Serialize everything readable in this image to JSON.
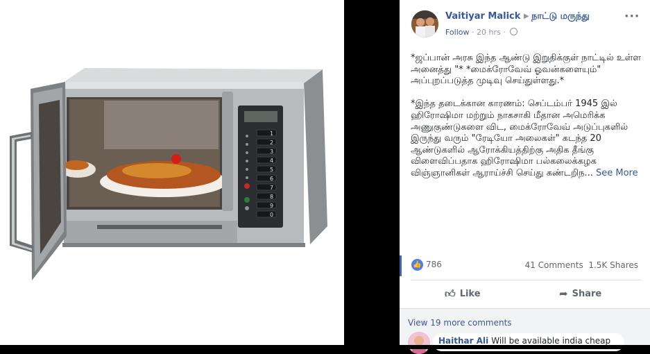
{
  "post": {
    "author": "Vaitiyar Malick",
    "page": "நாட்டு மருந்து",
    "follow": "Follow",
    "time": "20 hrs",
    "paragraph1": "*ஜப்பான் அரசு இந்த ஆண்டு இறுதிக்குள் நாட்டில் உள்ள அனைத்து \"* *மைக்ரோவேவ் ஓவன்களையும்\" அப்புறப்படுத்த முடிவு செய்துள்ளது.*",
    "paragraph2": "*இந்த தடைக்கான காரணம்: செப்டம்பர் 1945 இல் ஹிரோஷிமா மற்றும் நாகசாகி மீதான அமெரிக்க அணுகுண்டுகளை விட, மைக்ரோவேவ் அடுப்புகளில் இருந்து வரும் \"ரேடியோ அலைகள்\" கடந்த 20 ஆண்டுகளில் ஆரோக்கியத்திற்கு அதிக தீங்கு விளைவிப்பதாக ஹிரோஷிமா பல்கலைக்கழக விஞ்ஞானிகள் ஆராய்ச்சி செய்து கண்டறிந...",
    "see_more": "See More"
  },
  "stats": {
    "reactions": "786",
    "comments": "41 Comments",
    "shares": "1.5K Shares"
  },
  "actions": {
    "like": "Like",
    "share": "Share"
  },
  "comments": {
    "view_more": "View 19 more comments",
    "first_author": "Haithar Ali",
    "first_text": "Will be available india cheap"
  },
  "oven_keypad": [
    "1",
    "2",
    "3",
    "4",
    "5",
    "6",
    "7",
    "8",
    "9",
    "0"
  ],
  "icons": {
    "more": "more-options-icon",
    "globe": "globe-icon",
    "like": "thumbs-up-icon",
    "share": "share-arrow-icon"
  },
  "colors": {
    "link": "#365899",
    "facebook_blue": "#4267b2",
    "text": "#1d2129",
    "muted": "#90949c"
  }
}
